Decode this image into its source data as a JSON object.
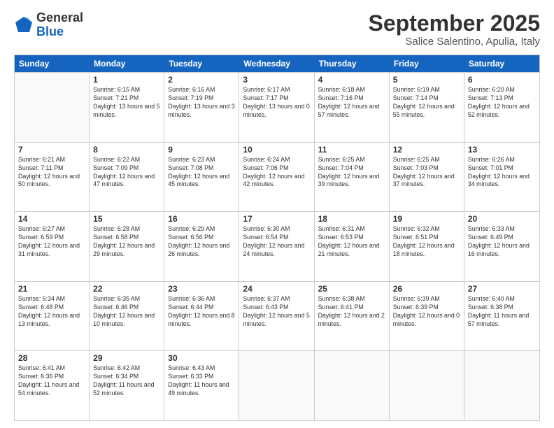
{
  "logo": {
    "general": "General",
    "blue": "Blue"
  },
  "title": "September 2025",
  "subtitle": "Salice Salentino, Apulia, Italy",
  "header_days": [
    "Sunday",
    "Monday",
    "Tuesday",
    "Wednesday",
    "Thursday",
    "Friday",
    "Saturday"
  ],
  "weeks": [
    [
      {
        "day": "",
        "info": ""
      },
      {
        "day": "1",
        "info": "Sunrise: 6:15 AM\nSunset: 7:21 PM\nDaylight: 13 hours\nand 5 minutes."
      },
      {
        "day": "2",
        "info": "Sunrise: 6:16 AM\nSunset: 7:19 PM\nDaylight: 13 hours\nand 3 minutes."
      },
      {
        "day": "3",
        "info": "Sunrise: 6:17 AM\nSunset: 7:17 PM\nDaylight: 13 hours\nand 0 minutes."
      },
      {
        "day": "4",
        "info": "Sunrise: 6:18 AM\nSunset: 7:16 PM\nDaylight: 12 hours\nand 57 minutes."
      },
      {
        "day": "5",
        "info": "Sunrise: 6:19 AM\nSunset: 7:14 PM\nDaylight: 12 hours\nand 55 minutes."
      },
      {
        "day": "6",
        "info": "Sunrise: 6:20 AM\nSunset: 7:13 PM\nDaylight: 12 hours\nand 52 minutes."
      }
    ],
    [
      {
        "day": "7",
        "info": "Sunrise: 6:21 AM\nSunset: 7:11 PM\nDaylight: 12 hours\nand 50 minutes."
      },
      {
        "day": "8",
        "info": "Sunrise: 6:22 AM\nSunset: 7:09 PM\nDaylight: 12 hours\nand 47 minutes."
      },
      {
        "day": "9",
        "info": "Sunrise: 6:23 AM\nSunset: 7:08 PM\nDaylight: 12 hours\nand 45 minutes."
      },
      {
        "day": "10",
        "info": "Sunrise: 6:24 AM\nSunset: 7:06 PM\nDaylight: 12 hours\nand 42 minutes."
      },
      {
        "day": "11",
        "info": "Sunrise: 6:25 AM\nSunset: 7:04 PM\nDaylight: 12 hours\nand 39 minutes."
      },
      {
        "day": "12",
        "info": "Sunrise: 6:25 AM\nSunset: 7:03 PM\nDaylight: 12 hours\nand 37 minutes."
      },
      {
        "day": "13",
        "info": "Sunrise: 6:26 AM\nSunset: 7:01 PM\nDaylight: 12 hours\nand 34 minutes."
      }
    ],
    [
      {
        "day": "14",
        "info": "Sunrise: 6:27 AM\nSunset: 6:59 PM\nDaylight: 12 hours\nand 31 minutes."
      },
      {
        "day": "15",
        "info": "Sunrise: 6:28 AM\nSunset: 6:58 PM\nDaylight: 12 hours\nand 29 minutes."
      },
      {
        "day": "16",
        "info": "Sunrise: 6:29 AM\nSunset: 6:56 PM\nDaylight: 12 hours\nand 26 minutes."
      },
      {
        "day": "17",
        "info": "Sunrise: 6:30 AM\nSunset: 6:54 PM\nDaylight: 12 hours\nand 24 minutes."
      },
      {
        "day": "18",
        "info": "Sunrise: 6:31 AM\nSunset: 6:53 PM\nDaylight: 12 hours\nand 21 minutes."
      },
      {
        "day": "19",
        "info": "Sunrise: 6:32 AM\nSunset: 6:51 PM\nDaylight: 12 hours\nand 18 minutes."
      },
      {
        "day": "20",
        "info": "Sunrise: 6:33 AM\nSunset: 6:49 PM\nDaylight: 12 hours\nand 16 minutes."
      }
    ],
    [
      {
        "day": "21",
        "info": "Sunrise: 6:34 AM\nSunset: 6:48 PM\nDaylight: 12 hours\nand 13 minutes."
      },
      {
        "day": "22",
        "info": "Sunrise: 6:35 AM\nSunset: 6:46 PM\nDaylight: 12 hours\nand 10 minutes."
      },
      {
        "day": "23",
        "info": "Sunrise: 6:36 AM\nSunset: 6:44 PM\nDaylight: 12 hours\nand 8 minutes."
      },
      {
        "day": "24",
        "info": "Sunrise: 6:37 AM\nSunset: 6:43 PM\nDaylight: 12 hours\nand 5 minutes."
      },
      {
        "day": "25",
        "info": "Sunrise: 6:38 AM\nSunset: 6:41 PM\nDaylight: 12 hours\nand 2 minutes."
      },
      {
        "day": "26",
        "info": "Sunrise: 6:39 AM\nSunset: 6:39 PM\nDaylight: 12 hours\nand 0 minutes."
      },
      {
        "day": "27",
        "info": "Sunrise: 6:40 AM\nSunset: 6:38 PM\nDaylight: 11 hours\nand 57 minutes."
      }
    ],
    [
      {
        "day": "28",
        "info": "Sunrise: 6:41 AM\nSunset: 6:36 PM\nDaylight: 11 hours\nand 54 minutes."
      },
      {
        "day": "29",
        "info": "Sunrise: 6:42 AM\nSunset: 6:34 PM\nDaylight: 11 hours\nand 52 minutes."
      },
      {
        "day": "30",
        "info": "Sunrise: 6:43 AM\nSunset: 6:33 PM\nDaylight: 11 hours\nand 49 minutes."
      },
      {
        "day": "",
        "info": ""
      },
      {
        "day": "",
        "info": ""
      },
      {
        "day": "",
        "info": ""
      },
      {
        "day": "",
        "info": ""
      }
    ]
  ]
}
